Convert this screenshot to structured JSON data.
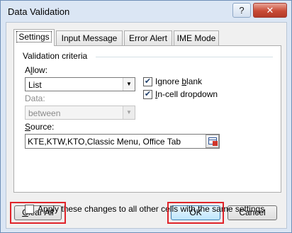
{
  "window": {
    "title": "Data Validation",
    "help_icon": "?",
    "close_icon": "✕"
  },
  "tabs": [
    {
      "label": "Settings",
      "active": true
    },
    {
      "label": "Input Message",
      "active": false
    },
    {
      "label": "Error Alert",
      "active": false
    },
    {
      "label": "IME Mode",
      "active": false
    }
  ],
  "settings": {
    "group_title": "Validation criteria",
    "allow": {
      "label_first": "A",
      "label_underlined": "l",
      "label_rest": "low:",
      "value": "List"
    },
    "data": {
      "label": "Data:",
      "value": "between",
      "enabled": false
    },
    "ignore_blank": {
      "checked": true,
      "label_first": "Ignore ",
      "label_underlined": "b",
      "label_rest": "lank"
    },
    "in_cell_dropdown": {
      "checked": true,
      "label_first": "",
      "label_underlined": "I",
      "label_rest": "n-cell dropdown"
    },
    "source": {
      "label_first": "",
      "label_underlined": "S",
      "label_rest": "ource:",
      "value": "KTE,KTW,KTO,Classic Menu, Office Tab"
    },
    "apply_all": {
      "checked": false,
      "label_first": "Ap",
      "label_underlined": "p",
      "label_rest": "ly these changes to all other cells with the same settings"
    }
  },
  "buttons": {
    "clear_all": {
      "label_first": "",
      "label_underlined": "C",
      "label_rest": "lear All"
    },
    "ok": "OK",
    "cancel": "Cancel"
  },
  "highlight_color": "#e0242a",
  "check_glyph": "✔",
  "dropdown_glyph": "▼"
}
